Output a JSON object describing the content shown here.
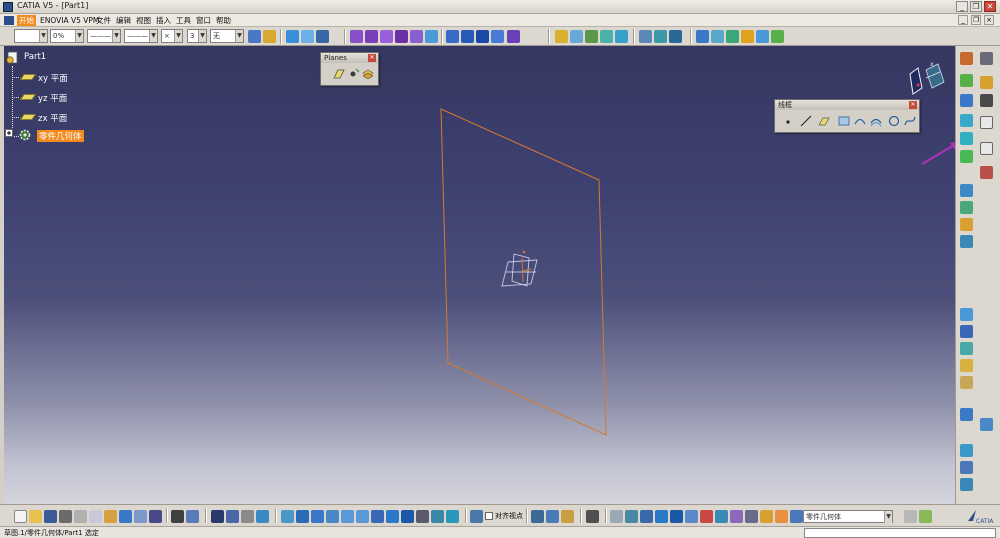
{
  "window": {
    "title": "CATIA V5 - [Part1]",
    "controls": {
      "minimize": "_",
      "restore": "❐",
      "close": "✕"
    }
  },
  "menubar": {
    "items": [
      "开始",
      "ENOVIA V5 VPM",
      "文件",
      "编辑",
      "视图",
      "插入",
      "工具",
      "窗口",
      "帮助"
    ],
    "active_item": "开始"
  },
  "toolbar_top": {
    "combo_color": "",
    "combo_transparency": "0%",
    "combo_linetype": "———",
    "combo_thickness": "———",
    "combo_point": "×",
    "combo_layer_num": "3",
    "combo_layer": "无"
  },
  "spec_tree": {
    "root": "Part1",
    "items": [
      "xy 平面",
      "yz 平面",
      "zx 平面",
      "零件几何体"
    ],
    "selected": "零件几何体"
  },
  "floating_toolbars": {
    "planes": {
      "title": "Planes"
    },
    "sketch_tools": {
      "title": "线框"
    }
  },
  "toolbar_bottom": {
    "snap_checkbox_label": "对齐视点",
    "combo_body": "零件几何体"
  },
  "statusbar": {
    "text": "草图.1/零件几何体/Part1 选定"
  },
  "colors": {
    "selection_orange": "#f28a1e",
    "plane_outline": "#d9772e",
    "viewport_top": "#353761",
    "viewport_bottom": "#d5d5de"
  },
  "icons": [
    "catia-logo-icon",
    "plane-icon",
    "point-icon",
    "line-icon",
    "sketch-icon",
    "compass-icon",
    "arrow-annotation-icon"
  ]
}
